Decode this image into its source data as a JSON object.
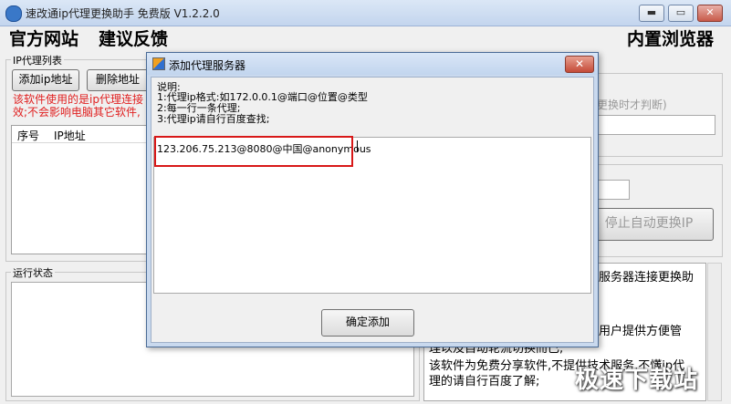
{
  "window": {
    "title": "速改通ip代理更换助手 免费版 V1.2.2.0",
    "min": "▬",
    "max": "▭",
    "close": "✕"
  },
  "menu": {
    "official_site": "官方网站",
    "feedback": "建议反馈",
    "browser": "内置浏览器"
  },
  "ip_group": {
    "label": "IP代理列表",
    "add_button": "添加ip地址",
    "delete_button": "删除地址",
    "warning_line1": "该软件使用的是ip代理连接",
    "warning_line2": "效;不会影响电脑其它软件,",
    "columns": [
      "序号",
      "IP地址"
    ]
  },
  "right_panel": {
    "hint": "更换时才判断)",
    "stop_button": "停止自动更换IP"
  },
  "status_group": {
    "label": "运行状态"
  },
  "info": {
    "line1": "服务器连接更换助",
    "line2": "用户提供方便管",
    "line3": "理以及自动轮流切换而已;",
    "line4": "该软件为免费分享软件,不提供技术服务,不懂ip代",
    "line5": "理的请自行百度了解;"
  },
  "dialog": {
    "title": "添加代理服务器",
    "close": "✕",
    "note_title": "说明:",
    "note1": "1:代理ip格式:如172.0.0.1@端口@位置@类型",
    "note2": "2:每一行一条代理;",
    "note3": "3:代理ip请自行百度查找;",
    "input_value": "123.206.75.213@8080@中国@anonymous",
    "confirm_button": "确定添加"
  },
  "watermark": "极速下载站",
  "colors": {
    "warning": "#e02020",
    "highlight_box": "#d81818",
    "title_bar": "#c3d5ee"
  }
}
